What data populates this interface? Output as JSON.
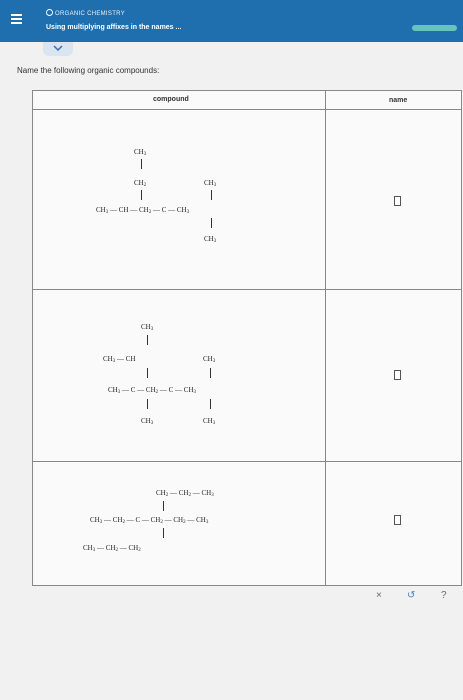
{
  "header": {
    "topic": "ORGANIC CHEMISTRY",
    "title": "Using multiplying affixes in the names ..."
  },
  "prompt": "Name the following organic compounds:",
  "table": {
    "col_compound": "compound",
    "col_name": "name",
    "compounds": [
      {
        "r1": "CH3",
        "r2": "CH2",
        "r2b": "CH3",
        "chain": "CH3 — CH — CH2 — C — CH3",
        "r4": "CH3"
      },
      {
        "r1": "CH3",
        "r2a": "CH3 — CH",
        "r2b": "CH3",
        "chain": "CH3 — C — CH2 — C — CH3",
        "r4a": "CH3",
        "r4b": "CH3"
      },
      {
        "top": "CH2 — CH2 — CH3",
        "chain": "CH3 — CH2 — C — CH2 — CH2 — CH3",
        "bottom": "CH3 — CH2 — CH2"
      }
    ]
  },
  "actions": {
    "clear": "×",
    "undo": "↺",
    "help": "?"
  }
}
